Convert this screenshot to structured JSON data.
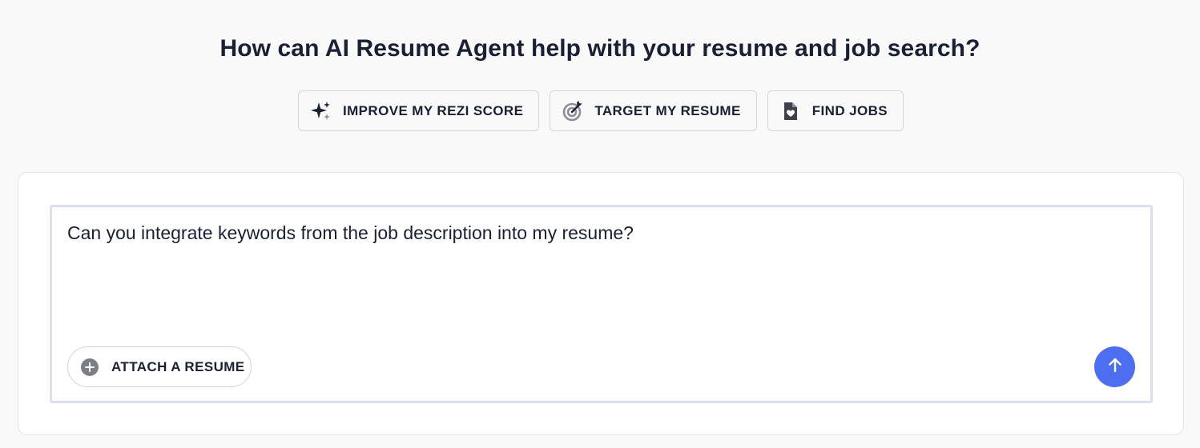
{
  "heading": "How can AI Resume Agent help with your resume and job search?",
  "actions": [
    {
      "label": "IMPROVE MY REZI SCORE",
      "icon": "sparkles-icon"
    },
    {
      "label": "TARGET MY RESUME",
      "icon": "target-icon"
    },
    {
      "label": "FIND JOBS",
      "icon": "document-heart-icon"
    }
  ],
  "composer": {
    "value": "Can you integrate keywords from the job description into my resume?",
    "attach_label": "ATTACH A RESUME",
    "attach_icon": "plus-circle-icon",
    "send_icon": "arrow-up-icon"
  },
  "colors": {
    "background": "#f9f9fa",
    "text": "#1a2033",
    "accent": "#4e6ef2",
    "border": "#d3d5dc"
  }
}
